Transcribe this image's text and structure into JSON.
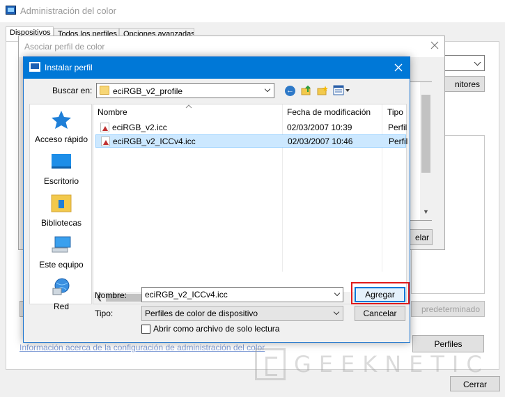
{
  "main_window": {
    "title": "Administración del color",
    "tabs": [
      "Dispositivos",
      "Todos los perfiles",
      "Opciones avanzadas"
    ],
    "monitors_button_partial": "nitores",
    "set_default_partial": "predeterminado",
    "info_link": "Información acerca de la configuración de administración del color",
    "profiles_button": "Perfiles",
    "close_button": "Cerrar"
  },
  "assoc_window": {
    "title": "Asociar perfil de color",
    "cancel_partial": "elar"
  },
  "install_dialog": {
    "title": "Instalar perfil",
    "lookin_label": "Buscar en:",
    "lookin_value": "eciRGB_v2_profile",
    "places": [
      "Acceso rápido",
      "Escritorio",
      "Bibliotecas",
      "Este equipo",
      "Red"
    ],
    "columns": [
      "Nombre",
      "Fecha de modificación",
      "Tipo"
    ],
    "files": [
      {
        "name": "eciRGB_v2.icc",
        "date": "02/03/2007 10:39",
        "type": "Perfil",
        "selected": false
      },
      {
        "name": "eciRGB_v2_ICCv4.icc",
        "date": "02/03/2007 10:46",
        "type": "Perfil",
        "selected": true
      }
    ],
    "name_label": "Nombre:",
    "name_value": "eciRGB_v2_ICCv4.icc",
    "type_label": "Tipo:",
    "type_value": "Perfiles de color de dispositivo",
    "readonly_label": "Abrir como archivo de solo lectura",
    "add_button": "Agregar",
    "cancel_button": "Cancelar"
  },
  "watermark": "GEEKNETIC",
  "colors": {
    "accent": "#0078d7",
    "highlight": "#e01b1b",
    "selection": "#cce8ff"
  }
}
